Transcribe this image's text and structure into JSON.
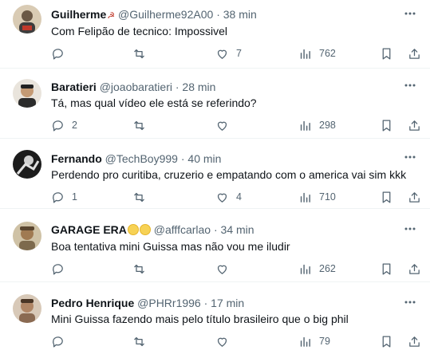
{
  "tweets": [
    {
      "name": "Guilherme",
      "name_suffix": "☭",
      "handle": "@Guilherme92A00",
      "dot": "·",
      "time": "38 min",
      "text": "Com Felipão de tecnico: Impossivel",
      "replies": "",
      "retweets": "",
      "likes": "7",
      "views": "762",
      "avatar_color": "#d9cbb4"
    },
    {
      "name": "Baratieri",
      "name_suffix": "",
      "handle": "@joaobaratieri",
      "dot": "·",
      "time": "28 min",
      "text": "Tá, mas qual vídeo ele está se referindo?",
      "replies": "2",
      "retweets": "",
      "likes": "",
      "views": "298",
      "avatar_color": "#6b5a48"
    },
    {
      "name": "Fernando",
      "name_suffix": "",
      "handle": "@TechBoy999",
      "dot": "·",
      "time": "40 min",
      "text": "Perdendo pro curitiba, cruzerio e empatando com o america vai sim kkk",
      "replies": "1",
      "retweets": "",
      "likes": "4",
      "views": "710",
      "avatar_color": "#2b2b2b"
    },
    {
      "name": "GARAGE ERA",
      "name_suffix": "",
      "handle": "@afffcarlao",
      "dot": "·",
      "time": "34 min",
      "text": "Boa tentativa mini Guissa mas não vou me iludir",
      "replies": "",
      "retweets": "",
      "likes": "",
      "views": "262",
      "avatar_color": "#b9a27a"
    },
    {
      "name": "Pedro Henrique",
      "name_suffix": "",
      "handle": "@PHRr1996",
      "dot": "·",
      "time": "17 min",
      "text": "Mini Guissa fazendo mais pelo título brasileiro que o big phil",
      "replies": "",
      "retweets": "",
      "likes": "",
      "views": "79",
      "avatar_color": "#c9a98c"
    }
  ],
  "colors": {
    "text_primary": "#0f1419",
    "text_secondary": "#536471",
    "divider": "#eff3f4"
  },
  "icons": [
    "more-icon",
    "reply-icon",
    "retweet-icon",
    "like-icon",
    "views-icon",
    "bookmark-icon",
    "share-icon"
  ]
}
